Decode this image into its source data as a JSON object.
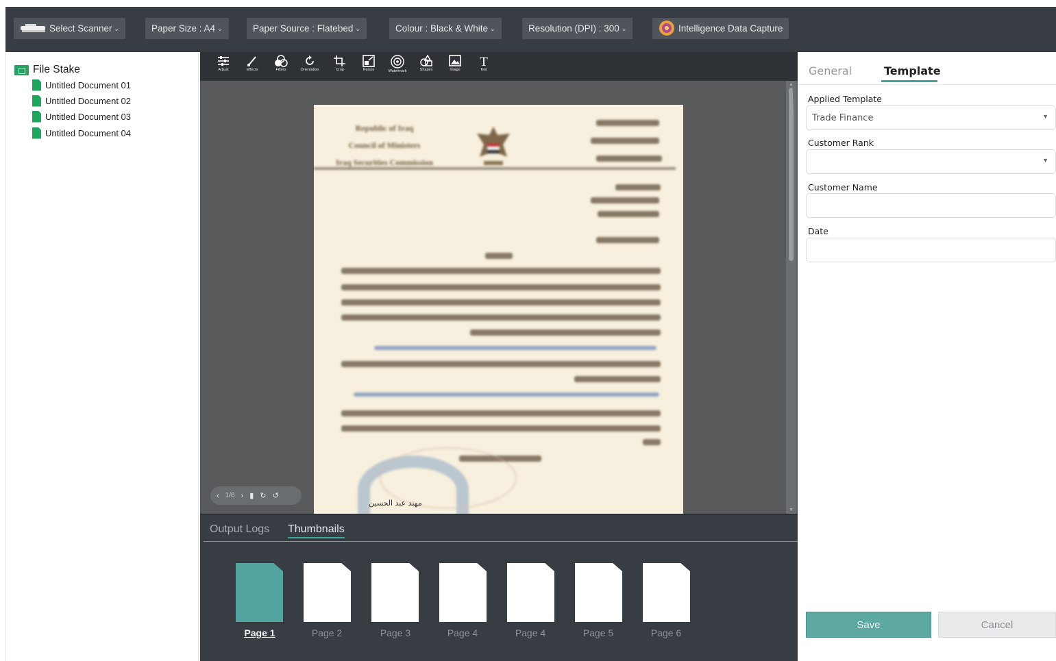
{
  "toolbar": {
    "select_scanner": "Select Scanner",
    "paper_size": "Paper Size : A4",
    "paper_source": "Paper Source : Flatebed",
    "colour": "Colour : Black & White",
    "resolution": "Resolution (DPI) : 300",
    "idc": "Intelligence Data Capture"
  },
  "file_tree": {
    "root": "File Stake",
    "items": [
      "Untitled Document 01",
      "Untitled Document 02",
      "Untitled Document 03",
      "Untitled Document 04"
    ]
  },
  "edit_tools": [
    {
      "label": "Adjust",
      "icon": "sliders-icon"
    },
    {
      "label": "Effects",
      "icon": "brush-icon"
    },
    {
      "label": "Filters",
      "icon": "filters-icon"
    },
    {
      "label": "Orientation",
      "icon": "rotate-icon"
    },
    {
      "label": "Crop",
      "icon": "crop-icon"
    },
    {
      "label": "Resize",
      "icon": "resize-icon"
    },
    {
      "label": "Watermark",
      "icon": "watermark-icon"
    },
    {
      "label": "Shapes",
      "icon": "shapes-icon"
    },
    {
      "label": "Image",
      "icon": "image-icon"
    },
    {
      "label": "Text",
      "icon": "text-icon"
    }
  ],
  "document_preview": {
    "header_lines": [
      "Republic of Iraq",
      "Council of Ministers",
      "Iraq Securities Commission"
    ]
  },
  "pager": {
    "counter": "1/6"
  },
  "bottom_tabs": {
    "output_logs": "Output Logs",
    "thumbnails": "Thumbnails"
  },
  "thumbnails": [
    "Page 1",
    "Page 2",
    "Page 3",
    "Page 4",
    "Page 4",
    "Page 5",
    "Page 6"
  ],
  "right_panel": {
    "tab_general": "General",
    "tab_template": "Template",
    "applied_template_label": "Applied Template",
    "applied_template_value": "Trade Finance",
    "customer_rank_label": "Customer Rank",
    "customer_rank_value": "",
    "customer_name_label": "Customer Name",
    "customer_name_value": "",
    "date_label": "Date",
    "date_value": "",
    "save": "Save",
    "cancel": "Cancel"
  },
  "colors": {
    "accent": "#3fa39a",
    "toolbar_bg": "#383d43",
    "doc_icon": "#1ea55e"
  }
}
